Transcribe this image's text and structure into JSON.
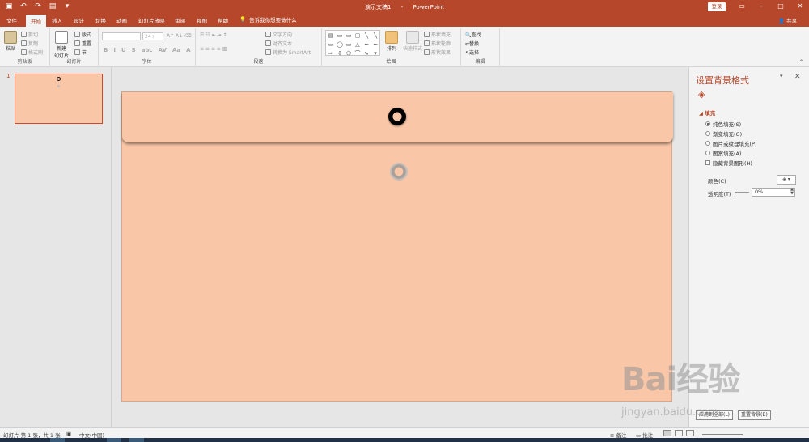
{
  "titlebar": {
    "doc_name": "演示文稿1",
    "separator": "-",
    "app_name": "PowerPoint",
    "login": "登录",
    "qat": [
      "save-icon",
      "undo-icon",
      "redo-icon",
      "present-icon",
      "customize-icon"
    ],
    "window_controls": [
      "ribbon-options-icon",
      "minimize-icon",
      "maximize-icon",
      "close-icon"
    ]
  },
  "tabs": {
    "items": [
      "文件",
      "开始",
      "插入",
      "设计",
      "切换",
      "动画",
      "幻灯片放映",
      "审阅",
      "视图",
      "帮助"
    ],
    "active": "开始",
    "tellme": "告诉我你想要做什么",
    "share": "共享"
  },
  "ribbon": {
    "clipboard": {
      "label": "剪贴板",
      "paste": "粘贴",
      "cut": "剪切",
      "copy": "复制",
      "format_painter": "格式刷"
    },
    "slides": {
      "label": "幻灯片",
      "new_slide": "新建",
      "new_slide2": "幻灯片",
      "layout": "版式",
      "reset": "重置",
      "section": "节"
    },
    "font": {
      "label": "字体",
      "size_value": "24+",
      "format": [
        "B",
        "I",
        "U",
        "S",
        "abc",
        "AV",
        "Aa",
        "A"
      ]
    },
    "paragraph": {
      "label": "段落",
      "text_direction": "文字方向",
      "align_text": "对齐文本",
      "smartart": "转换为 SmartArt"
    },
    "drawing": {
      "label": "绘图",
      "arrange": "排列",
      "quick_styles": "快速样式",
      "shape_fill": "形状填充",
      "shape_outline": "形状轮廓",
      "shape_effects": "形状效果"
    },
    "editing": {
      "label": "编辑",
      "find": "查找",
      "replace": "替换",
      "select": "选择"
    }
  },
  "thumbnails": {
    "number": "1"
  },
  "format_pane": {
    "title": "设置背景格式",
    "section": "填充",
    "options": [
      "纯色填充(S)",
      "渐变填充(G)",
      "图片或纹理填充(P)",
      "图案填充(A)"
    ],
    "selected": "纯色填充(S)",
    "hide_bg": "隐藏背景图形(H)",
    "color_label": "颜色(C)",
    "transparency_label": "透明度(T)",
    "transparency_value": "0%",
    "reset": "重置背景(B)",
    "apply_all": "应用到全部(L)"
  },
  "statusbar": {
    "slide_info": "幻灯片 第 1 张，共 1 张",
    "language": "中文(中国)",
    "notes": "备注",
    "comments": "批注"
  },
  "watermark": {
    "main": "Bai经验",
    "sub": "jingyan.baidu.com"
  },
  "colors": {
    "accent": "#b7472a",
    "slide_bg": "#f9c6a7",
    "ribbon_bg": "#f3f3f3"
  }
}
